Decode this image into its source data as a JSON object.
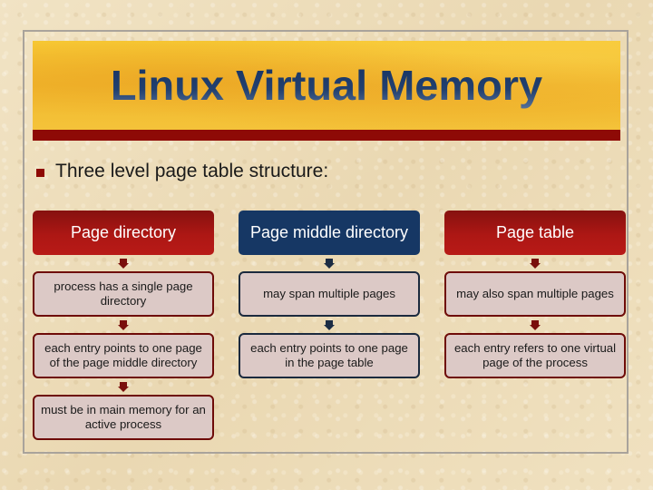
{
  "slide": {
    "title": "Linux Virtual Memory",
    "bullet": "Three level page table structure:",
    "colors": {
      "red_header": "#ad1714",
      "blue_header": "#163764",
      "banner_stripe": "#8e0a06",
      "banner_gold": "#f4c33a",
      "box_fill": "#dcc9c6"
    }
  },
  "columns": [
    {
      "header": "Page directory",
      "theme": "red",
      "items": [
        "process has a single page directory",
        "each entry points to one page of the page middle directory",
        "must be in main memory for an active process"
      ]
    },
    {
      "header": "Page middle directory",
      "theme": "blue",
      "items": [
        "may span multiple pages",
        "each entry points to one page in the page table"
      ]
    },
    {
      "header": "Page table",
      "theme": "red",
      "items": [
        "may also span multiple pages",
        "each entry refers to one virtual page of the process"
      ]
    }
  ]
}
